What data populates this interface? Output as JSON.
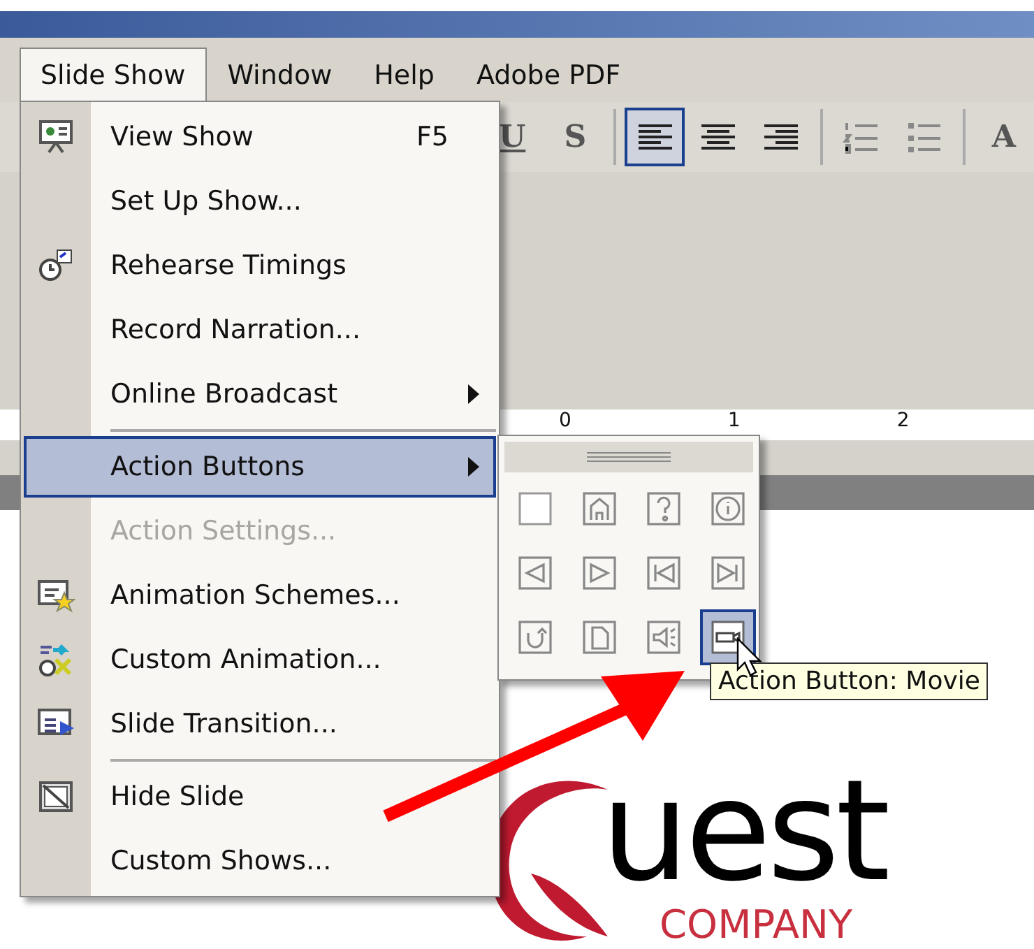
{
  "menubar": {
    "items": [
      {
        "label": "Slide Show",
        "selected": true
      },
      {
        "label": "Window",
        "selected": false
      },
      {
        "label": "Help",
        "selected": false
      },
      {
        "label": "Adobe PDF",
        "selected": false
      }
    ]
  },
  "toolbar": {
    "buttons": [
      {
        "kind": "underline",
        "label": "U",
        "selected": false
      },
      {
        "kind": "shadow",
        "label": "S",
        "selected": false
      },
      {
        "kind": "align_left",
        "selected": true
      },
      {
        "kind": "align_center",
        "selected": false
      },
      {
        "kind": "align_right",
        "selected": false
      },
      {
        "kind": "numbering",
        "selected": false
      },
      {
        "kind": "bullets",
        "selected": false
      },
      {
        "kind": "font_size",
        "label": "A",
        "selected": false
      }
    ]
  },
  "ruler": {
    "labels": [
      "0",
      "1",
      "2"
    ]
  },
  "menu": {
    "items": [
      {
        "label": "View Show",
        "shortcut": "F5",
        "submenu": false,
        "disabled": false,
        "selected": false,
        "separator_before": false
      },
      {
        "label": "Set Up Show...",
        "submenu": false,
        "disabled": false,
        "selected": false,
        "separator_before": false
      },
      {
        "label": "Rehearse Timings",
        "submenu": false,
        "disabled": false,
        "selected": false,
        "separator_before": false
      },
      {
        "label": "Record Narration...",
        "submenu": false,
        "disabled": false,
        "selected": false,
        "separator_before": false
      },
      {
        "label": "Online Broadcast",
        "submenu": true,
        "disabled": false,
        "selected": false,
        "separator_before": false
      },
      {
        "label": "Action Buttons",
        "submenu": true,
        "disabled": false,
        "selected": true,
        "separator_before": true
      },
      {
        "label": "Action Settings...",
        "submenu": false,
        "disabled": true,
        "selected": false,
        "separator_before": false
      },
      {
        "label": "Animation Schemes...",
        "submenu": false,
        "disabled": false,
        "selected": false,
        "separator_before": false
      },
      {
        "label": "Custom Animation...",
        "submenu": false,
        "disabled": false,
        "selected": false,
        "separator_before": false
      },
      {
        "label": "Slide Transition...",
        "submenu": false,
        "disabled": false,
        "selected": false,
        "separator_before": false
      },
      {
        "label": "Hide Slide",
        "submenu": false,
        "disabled": false,
        "selected": false,
        "separator_before": true
      },
      {
        "label": "Custom Shows...",
        "submenu": false,
        "disabled": false,
        "selected": false,
        "separator_before": false
      }
    ]
  },
  "action_buttons": {
    "buttons": [
      {
        "kind": "custom",
        "selected": false
      },
      {
        "kind": "home",
        "selected": false
      },
      {
        "kind": "help",
        "selected": false
      },
      {
        "kind": "information",
        "selected": false
      },
      {
        "kind": "back",
        "selected": false
      },
      {
        "kind": "forward",
        "selected": false
      },
      {
        "kind": "beginning",
        "selected": false
      },
      {
        "kind": "end",
        "selected": false
      },
      {
        "kind": "return",
        "selected": false
      },
      {
        "kind": "document",
        "selected": false
      },
      {
        "kind": "sound",
        "selected": false
      },
      {
        "kind": "movie",
        "selected": true
      }
    ]
  },
  "tooltip": "Action Button: Movie",
  "slide": {
    "logo_text": "uest",
    "logo_subtitle": "COMPANY"
  }
}
